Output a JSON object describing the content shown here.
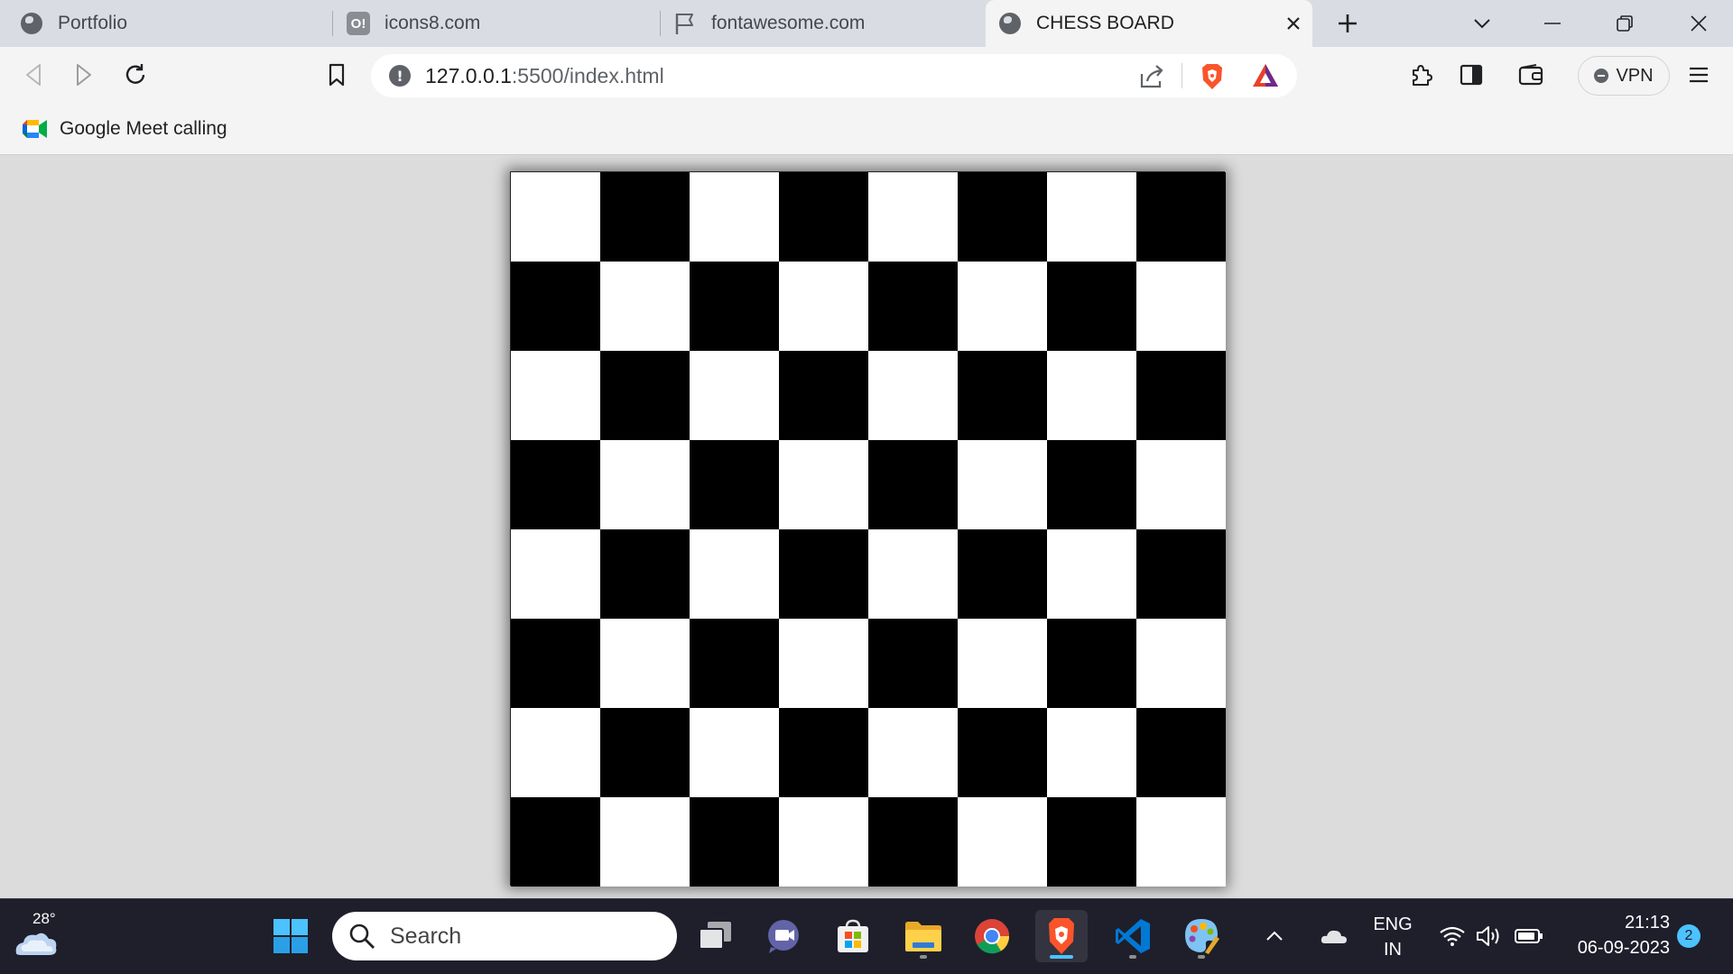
{
  "tabs": [
    {
      "label": "Portfolio",
      "icon": "globe-icon"
    },
    {
      "label": "icons8.com",
      "icon": "icons8-icon",
      "badge": "O!"
    },
    {
      "label": "fontawesome.com",
      "icon": "flag-icon"
    },
    {
      "label": "CHESS BOARD",
      "icon": "globe-icon",
      "active": true
    }
  ],
  "toolbar": {
    "url_host": "127.0.0.1",
    "url_rest": ":5500/index.html",
    "info_glyph": "!",
    "vpn_label": "VPN"
  },
  "bookmarks": [
    {
      "label": "Google Meet calling",
      "icon": "google-meet-icon"
    }
  ],
  "board": {
    "rows": 8,
    "cols": 8,
    "first_square": "light",
    "light_color": "#ffffff",
    "dark_color": "#000000"
  },
  "taskbar": {
    "weather_temp": "28°",
    "search_placeholder": "Search",
    "language_line1": "ENG",
    "language_line2": "IN",
    "time": "21:13",
    "date": "06-09-2023",
    "notification_count": "2"
  }
}
